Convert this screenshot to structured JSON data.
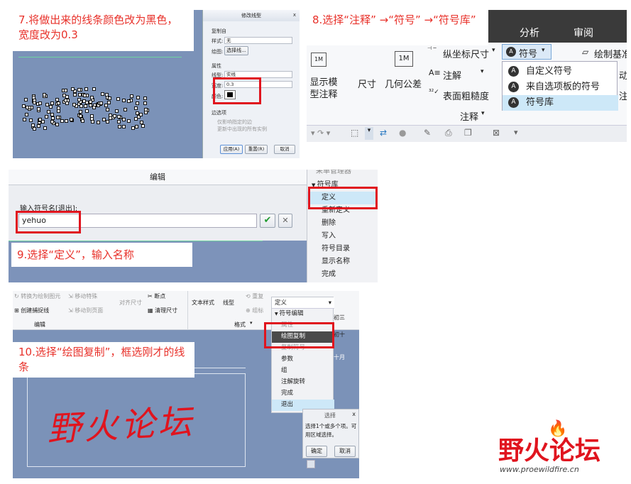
{
  "panel1": {
    "caption": "7.将做出来的线条颜色改为黑色，宽度改为0.3",
    "dialog_title": "修改线型",
    "dialog_close": "x",
    "copy_from": "复制自",
    "style_label": "样式:",
    "style_value": "无",
    "drawing_label": "绘图:",
    "select_line_btn": "选择线...",
    "attributes": "属性",
    "linetype_label": "线型:",
    "linetype_value": "实线",
    "width_label": "宽度:",
    "width_value": "0.3",
    "color_label": "颜色:",
    "edge_options": "边选项",
    "edge_opt1": "仅影响指定的边",
    "edge_opt2": "更新中出现的所有实例",
    "apply_btn": "应用(A)",
    "reset_btn": "重置(R)",
    "cancel_btn": "取消"
  },
  "panel2": {
    "caption": "8.选择“注释” →“符号” →“符号库”",
    "tab_analysis": "分析",
    "tab_review": "审阅",
    "ordinate_dim": "纵坐标尺寸",
    "symbol": "符号",
    "draw_datum": "绘制基准",
    "show_model_annotation": "显示模型注释",
    "dimension": "尺寸",
    "gtol": "几何公差",
    "note": "注解",
    "surface_finish": "表面粗糙度",
    "group_annotation": "注释",
    "menu_items": [
      "自定义符号",
      "来自选项板的符号",
      "符号库"
    ],
    "cut_right1": "动称",
    "cut_right2": "注释"
  },
  "panel3": {
    "dialog_title": "编辑",
    "input_label": "输入符号名[退出]:",
    "input_value": "yehuo",
    "caption": "9.选择“定义”，输入名称",
    "menu_top_cut": "采单管理器",
    "menu_header": "符号库",
    "menu_items": [
      "定义",
      "重新定义",
      "删除",
      "写入",
      "符号目录",
      "显示名称",
      "完成"
    ]
  },
  "panel4": {
    "toolbar_items": [
      "转换为绘制图元",
      "移动特殊",
      "创建捕捉线",
      "移动到页面",
      "对齐尺寸",
      "断点",
      "清理尺寸",
      "文本样式",
      "线型",
      "重复",
      "组标"
    ],
    "group_edit": "编辑",
    "group_format": "格式",
    "define_dropdown": "定义",
    "menu_header": "符号编辑",
    "menu_items": [
      "属性",
      "绘图复制",
      "复制符号",
      "参数",
      "组",
      "注解旋转",
      "完成",
      "退出"
    ],
    "caption": "10.选择“绘图复制”，框选刚才的线条",
    "handwriting": "野火论坛",
    "cal1": "初三",
    "cal2": "初十",
    "cal3": "十月",
    "sel_title": "选择",
    "sel_close": "x",
    "sel_text": "选择1个或多个项。可用区域选择。",
    "sel_ok": "确定",
    "sel_cancel": "取消"
  },
  "logo": {
    "text": "野火论坛",
    "url": "www.proewildfire.cn"
  }
}
